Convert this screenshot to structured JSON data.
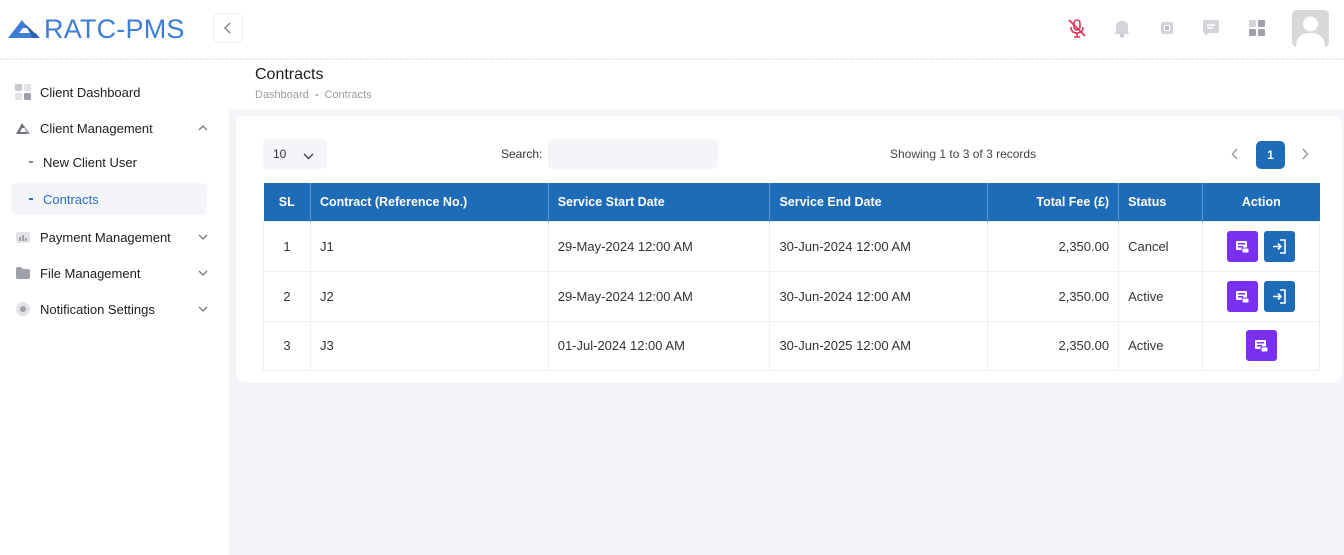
{
  "app": {
    "brand": "RATC-PMS"
  },
  "sidebar": {
    "items": [
      {
        "label": "Client Dashboard",
        "icon": "grid-icon"
      },
      {
        "label": "Client Management",
        "icon": "triangle-logo-icon",
        "expanded": true,
        "children": [
          {
            "label": "New Client User"
          },
          {
            "label": "Contracts",
            "active": true
          }
        ]
      },
      {
        "label": "Payment Management",
        "icon": "wallet-icon"
      },
      {
        "label": "File Management",
        "icon": "folder-icon"
      },
      {
        "label": "Notification Settings",
        "icon": "settings-icon"
      }
    ]
  },
  "page": {
    "title": "Contracts",
    "breadcrumb": [
      "Dashboard",
      "-",
      "Contracts"
    ]
  },
  "table_controls": {
    "page_length": "10",
    "search_label": "Search:",
    "search_value": "",
    "showing": "Showing 1 to 3 of 3 records",
    "current_page": "1"
  },
  "table": {
    "columns": [
      "SL",
      "Contract (Reference No.)",
      "Service Start Date",
      "Service End Date",
      "Total Fee (£)",
      "Status",
      "Action"
    ],
    "rows": [
      {
        "sl": "1",
        "ref": "J1",
        "start": "29-May-2024 12:00 AM",
        "end": "30-Jun-2024 12:00 AM",
        "fee": "2,350.00",
        "status": "Cancel"
      },
      {
        "sl": "2",
        "ref": "J2",
        "start": "29-May-2024 12:00 AM",
        "end": "30-Jun-2024 12:00 AM",
        "fee": "2,350.00",
        "status": "Active"
      },
      {
        "sl": "3",
        "ref": "J3",
        "start": "01-Jul-2024 12:00 AM",
        "end": "30-Jun-2025 12:00 AM",
        "fee": "2,350.00",
        "status": "Active"
      }
    ]
  },
  "colors": {
    "primary": "#1e6bb8",
    "action_purple": "#7b2ff0",
    "brand": "#3d7dd6",
    "mic_muted": "#e0375a"
  }
}
